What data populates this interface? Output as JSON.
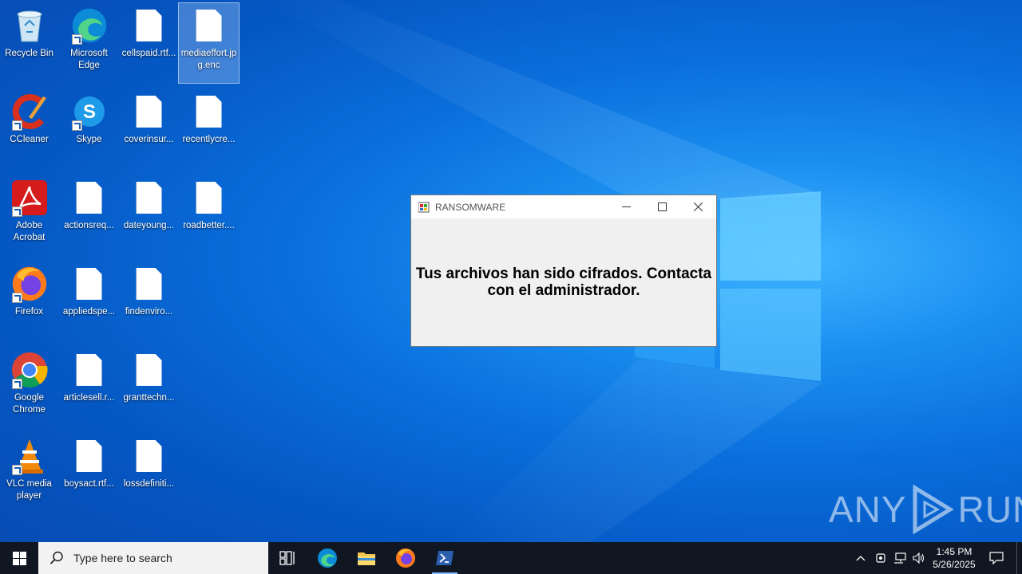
{
  "desktop": {
    "icons": [
      {
        "label": "Recycle Bin"
      },
      {
        "label": "Microsoft Edge"
      },
      {
        "label": "cellspaid.rtf..."
      },
      {
        "label": "mediaeffort.jpg.enc"
      },
      {
        "label": "CCleaner"
      },
      {
        "label": "Skype"
      },
      {
        "label": "coverinsur..."
      },
      {
        "label": "recentlycre..."
      },
      {
        "label": "Adobe Acrobat"
      },
      {
        "label": "actionsreq..."
      },
      {
        "label": "dateyoung..."
      },
      {
        "label": "roadbetter...."
      },
      {
        "label": "Firefox"
      },
      {
        "label": "appliedspe..."
      },
      {
        "label": "findenviro..."
      },
      {
        "label": "Google Chrome"
      },
      {
        "label": "articlesell.r..."
      },
      {
        "label": "granttechn..."
      },
      {
        "label": "VLC media player"
      },
      {
        "label": "boysact.rtf..."
      },
      {
        "label": "lossdefiniti..."
      }
    ]
  },
  "dialog": {
    "title": "RANSOMWARE",
    "message": "Tus archivos han sido cifrados. Contacta con el administrador.",
    "minimize_glyph": "—",
    "maximize_glyph": "☐",
    "close_glyph": "✕"
  },
  "watermark": {
    "text_left": "ANY",
    "text_right": "RUN"
  },
  "taskbar": {
    "search_placeholder": "Type here to search",
    "clock_time": "1:45 PM",
    "clock_date": "5/26/2025",
    "accent": "#101722"
  }
}
